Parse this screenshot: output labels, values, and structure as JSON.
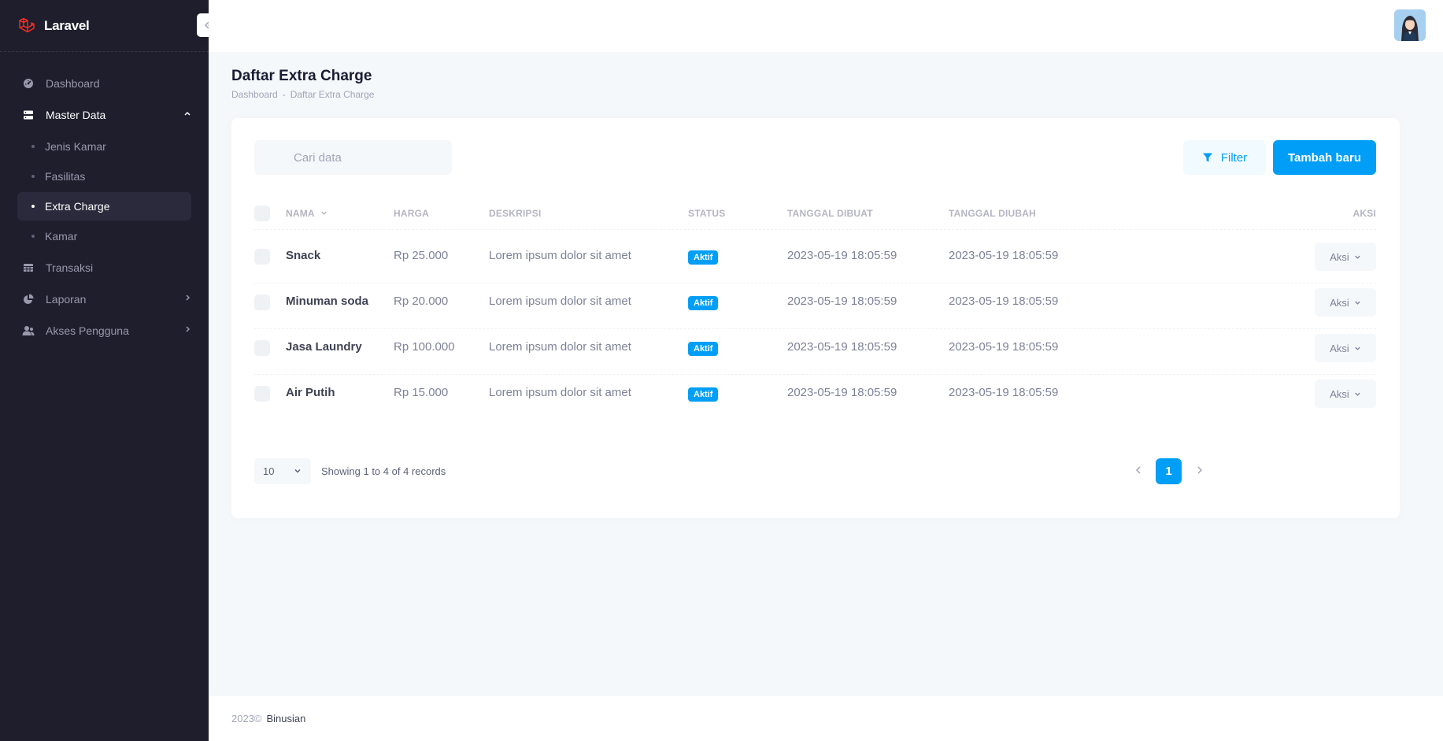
{
  "brand": {
    "name": "Laravel"
  },
  "sidebar": {
    "items": [
      {
        "label": "Dashboard",
        "icon": "dashboard-icon"
      },
      {
        "label": "Master Data",
        "icon": "database-icon",
        "expanded": true
      },
      {
        "label": "Transaksi",
        "icon": "table-icon"
      },
      {
        "label": "Laporan",
        "icon": "pie-chart-icon"
      },
      {
        "label": "Akses Pengguna",
        "icon": "users-icon"
      }
    ],
    "master_data_sub": [
      {
        "label": "Jenis Kamar"
      },
      {
        "label": "Fasilitas"
      },
      {
        "label": "Extra Charge",
        "active": true
      },
      {
        "label": "Kamar"
      }
    ]
  },
  "page": {
    "title": "Daftar Extra Charge",
    "breadcrumb": [
      "Dashboard",
      "-",
      "Daftar Extra Charge"
    ]
  },
  "toolbar": {
    "search_placeholder": "Cari data",
    "filter_label": "Filter",
    "add_label": "Tambah baru"
  },
  "table": {
    "headers": [
      "Nama",
      "Harga",
      "Deskripsi",
      "Status",
      "Tanggal Dibuat",
      "Tanggal Diubah",
      "Aksi"
    ],
    "rows": [
      {
        "nama": "Snack",
        "harga": "Rp 25.000",
        "deskripsi": "Lorem ipsum dolor sit amet",
        "status": "Aktif",
        "dibuat": "2023-05-19 18:05:59",
        "diubah": "2023-05-19 18:05:59",
        "aksi": "Aksi"
      },
      {
        "nama": "Minuman soda",
        "harga": "Rp 20.000",
        "deskripsi": "Lorem ipsum dolor sit amet",
        "status": "Aktif",
        "dibuat": "2023-05-19 18:05:59",
        "diubah": "2023-05-19 18:05:59",
        "aksi": "Aksi"
      },
      {
        "nama": "Jasa Laundry",
        "harga": "Rp 100.000",
        "deskripsi": "Lorem ipsum dolor sit amet",
        "status": "Aktif",
        "dibuat": "2023-05-19 18:05:59",
        "diubah": "2023-05-19 18:05:59",
        "aksi": "Aksi"
      },
      {
        "nama": "Air Putih",
        "harga": "Rp 15.000",
        "deskripsi": "Lorem ipsum dolor sit amet",
        "status": "Aktif",
        "dibuat": "2023-05-19 18:05:59",
        "diubah": "2023-05-19 18:05:59",
        "aksi": "Aksi"
      }
    ]
  },
  "pagination": {
    "page_size": "10",
    "records_text": "Showing 1 to 4 of 4 records",
    "current_page": "1"
  },
  "footer": {
    "year": "2023©",
    "owner": "Binusian"
  },
  "colors": {
    "primary": "#009ef7",
    "sidebar_bg": "#1e1e2d",
    "brand_red": "#ff2d20"
  }
}
